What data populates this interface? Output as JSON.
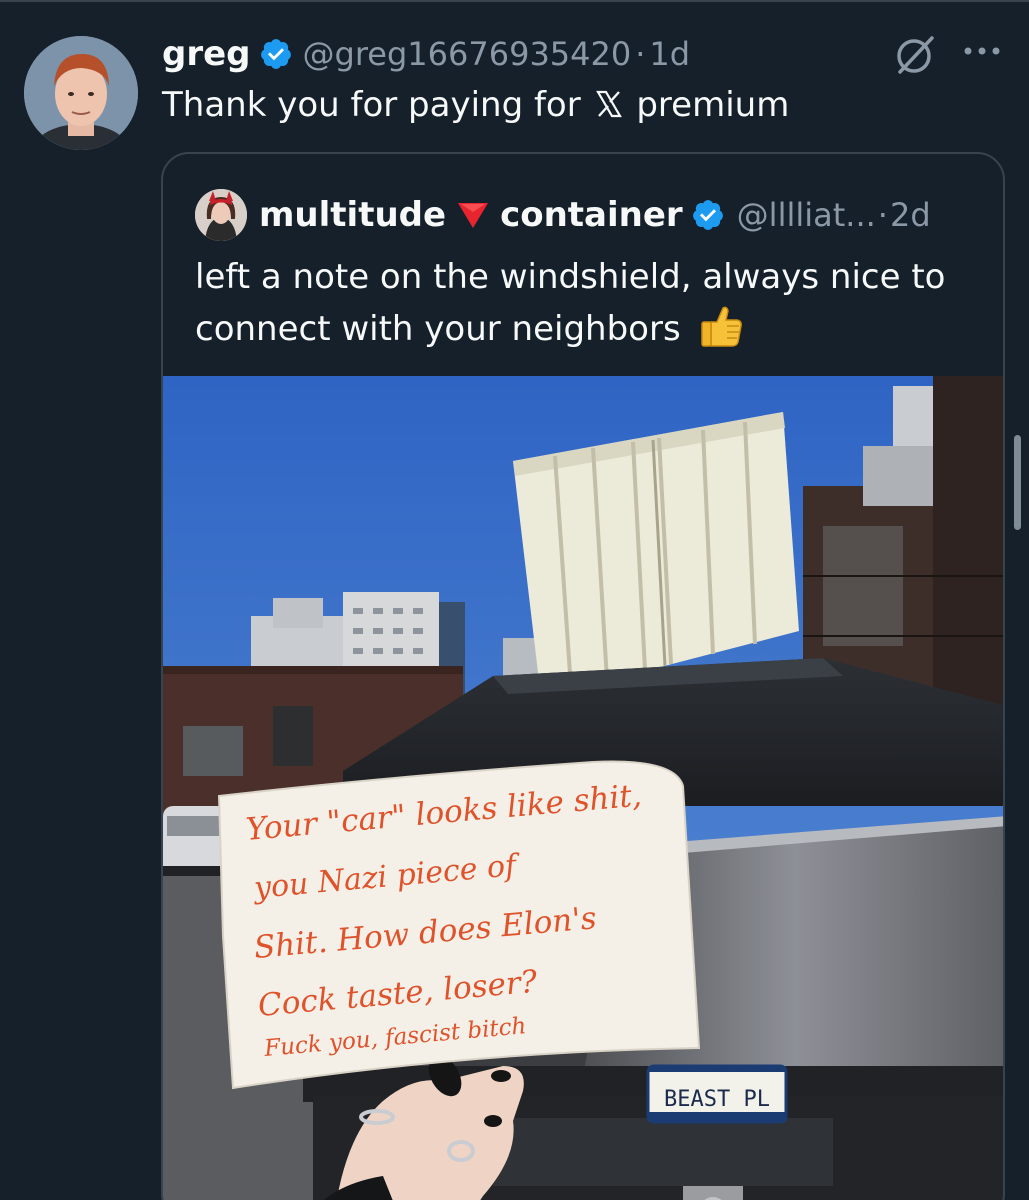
{
  "tweet": {
    "display_name": "greg",
    "handle": "@greg16676935420",
    "separator": "·",
    "time": "1d",
    "text_before_logo": "Thank you for paying for",
    "text_after_logo": "premium"
  },
  "quoted_tweet": {
    "name_part1": "multitude",
    "name_part2": "container",
    "handle": "@lllliat...",
    "separator": "·",
    "time": "2d",
    "text": "left a note on the windshield, always nice to connect with your neighbors",
    "photo": {
      "note_lines": [
        "Your \"car\" looks like shit,",
        "you Nazi piece of",
        "Shit. How does Elon's",
        "Cock taste, loser?",
        "Fuck you, fascist bitch"
      ],
      "license_plate": "BEAST PL"
    }
  },
  "icons": {
    "verified": "verified-badge-icon",
    "grok": "grok-icon",
    "more": "more-options-icon",
    "x_logo": "x-logo-icon",
    "flag": "red-triangle-icon",
    "thumbs_up": "thumbs-up-emoji-icon"
  },
  "colors": {
    "background": "#15202b",
    "verified": "#1d9bf0",
    "secondary_text": "#8b98a5",
    "border": "#38444d",
    "note_ink": "#e0522a"
  }
}
